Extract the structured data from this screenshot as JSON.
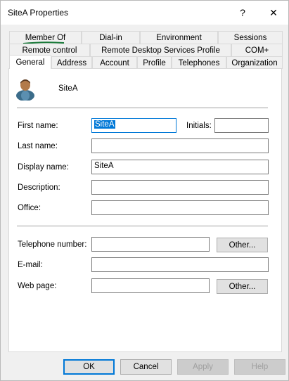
{
  "window": {
    "title": "SiteA Properties",
    "help_glyph": "?",
    "close_glyph": "✕"
  },
  "tabs": {
    "row1": [
      "Member Of",
      "Dial-in",
      "Environment",
      "Sessions"
    ],
    "row2": [
      "Remote control",
      "Remote Desktop Services Profile",
      "COM+"
    ],
    "row3": [
      "General",
      "Address",
      "Account",
      "Profile",
      "Telephones",
      "Organization"
    ],
    "active": "General"
  },
  "general": {
    "object_name": "SiteA",
    "object_icon": "user-icon",
    "first_name_label": "First name:",
    "first_name_value": "SiteA",
    "initials_label": "Initials:",
    "initials_value": "",
    "last_name_label": "Last name:",
    "last_name_value": "",
    "display_name_label": "Display name:",
    "display_name_value": "SiteA",
    "description_label": "Description:",
    "description_value": "",
    "office_label": "Office:",
    "office_value": "",
    "telephone_label": "Telephone number:",
    "telephone_value": "",
    "telephone_other_label": "Other...",
    "email_label": "E-mail:",
    "email_value": "",
    "webpage_label": "Web page:",
    "webpage_value": "",
    "webpage_other_label": "Other..."
  },
  "footer": {
    "ok_label": "OK",
    "cancel_label": "Cancel",
    "apply_label": "Apply",
    "help_label": "Help"
  },
  "colors": {
    "accent": "#0078d7",
    "annotation": "#1a7a3a"
  }
}
